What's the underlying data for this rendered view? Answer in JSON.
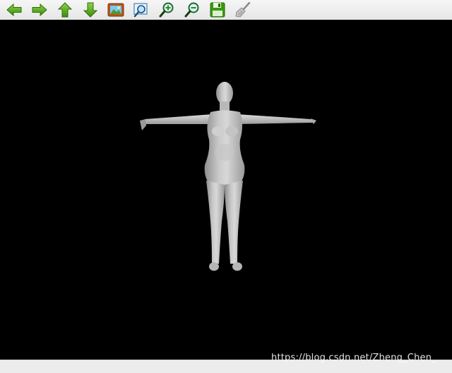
{
  "toolbar": {
    "buttons": [
      {
        "name": "back-button",
        "icon": "arrow-left-icon"
      },
      {
        "name": "forward-button",
        "icon": "arrow-right-icon"
      },
      {
        "name": "up-button",
        "icon": "arrow-up-icon"
      },
      {
        "name": "down-button",
        "icon": "arrow-down-icon"
      },
      {
        "name": "load-image-button",
        "icon": "image-icon"
      },
      {
        "name": "zoom-fit-button",
        "icon": "zoom-fit-icon"
      },
      {
        "name": "zoom-in-button",
        "icon": "zoom-in-icon"
      },
      {
        "name": "zoom-out-button",
        "icon": "zoom-out-icon"
      },
      {
        "name": "save-button",
        "icon": "save-floppy-icon"
      },
      {
        "name": "clear-button",
        "icon": "broom-icon"
      }
    ]
  },
  "colors": {
    "accent_green": "#3f9a10",
    "viewport_bg": "#000000",
    "toolbar_bg": "#ececec",
    "model_gray": "#bdbdbd"
  },
  "viewport": {
    "content": "3d-human-mesh-model"
  },
  "watermark": {
    "text": "https://blog.csdn.net/Zheng_Chen_"
  }
}
